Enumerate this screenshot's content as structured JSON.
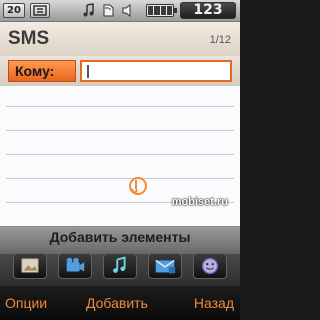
{
  "status_bar": {
    "signal_number": "20",
    "signal_icon": "network-icon",
    "icons": [
      "music-icon",
      "memory-card-icon",
      "speaker-icon"
    ],
    "battery_icon": "battery-icon",
    "time": "123"
  },
  "header": {
    "title": "SMS",
    "counter": "1/12"
  },
  "recipient": {
    "label": "Кому:",
    "value": ""
  },
  "insert_panel": {
    "title": "Добавить элементы",
    "items": [
      {
        "icon": "image-icon"
      },
      {
        "icon": "video-icon"
      },
      {
        "icon": "music-note-icon"
      },
      {
        "icon": "message-template-icon"
      },
      {
        "icon": "emoticon-icon"
      }
    ]
  },
  "watermark": "mobiset.ru",
  "softkeys": {
    "left": "Опции",
    "center": "Добавить",
    "right": "Назад"
  },
  "colors": {
    "accent": "#e9661b",
    "softkey_text": "#f08a3a"
  }
}
